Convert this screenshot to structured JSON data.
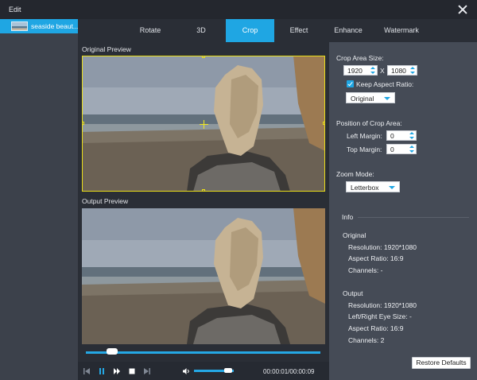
{
  "window": {
    "title": "Edit"
  },
  "sidebar": {
    "files": [
      {
        "name": "seaside beaut..."
      }
    ]
  },
  "tabs": [
    {
      "label": "Rotate",
      "active": false
    },
    {
      "label": "3D",
      "active": false
    },
    {
      "label": "Crop",
      "active": true
    },
    {
      "label": "Effect",
      "active": false
    },
    {
      "label": "Enhance",
      "active": false
    },
    {
      "label": "Watermark",
      "active": false
    }
  ],
  "preview": {
    "original_label": "Original Preview",
    "output_label": "Output Preview"
  },
  "player": {
    "timecode": "00:00:01/00:00:09",
    "progress": 0.11,
    "volume": 0.8,
    "icons": [
      "skip-back-icon",
      "pause-icon",
      "play-forward-icon",
      "stop-icon",
      "skip-forward-icon",
      "volume-icon"
    ]
  },
  "crop": {
    "area_size_label": "Crop Area Size:",
    "width": "1920",
    "separator": "X",
    "height": "1080",
    "keep_aspect_label": "Keep Aspect Ratio:",
    "keep_aspect_checked": true,
    "aspect_value": "Original",
    "position_label": "Position of Crop Area:",
    "left_margin_label": "Left Margin:",
    "left_margin": "0",
    "top_margin_label": "Top Margin:",
    "top_margin": "0",
    "zoom_label": "Zoom Mode:",
    "zoom_value": "Letterbox"
  },
  "info": {
    "heading": "Info",
    "original_heading": "Original",
    "original_resolution": "Resolution: 1920*1080",
    "original_aspect": "Aspect Ratio: 16:9",
    "original_channels": "Channels: -",
    "output_heading": "Output",
    "output_resolution": "Resolution: 1920*1080",
    "output_eye_size": "Left/Right Eye Size: -",
    "output_aspect": "Aspect Ratio: 16:9",
    "output_channels": "Channels: 2"
  },
  "actions": {
    "restore_defaults": "Restore Defaults"
  },
  "colors": {
    "accent": "#1fa6e3",
    "crop_box": "#e9dd19",
    "panel": "#454b56",
    "background": "#2a2e36"
  }
}
